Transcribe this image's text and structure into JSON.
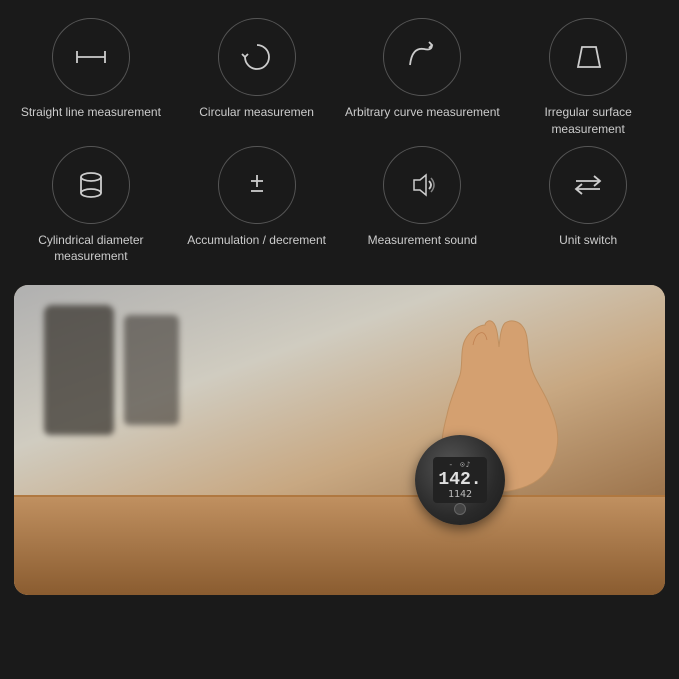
{
  "features": [
    {
      "id": "straight-line",
      "label": "Straight line\nmeasurement",
      "icon": "ruler"
    },
    {
      "id": "circular",
      "label": "Circular\nmeasuremen",
      "icon": "circle-arrow"
    },
    {
      "id": "arbitrary-curve",
      "label": "Arbitrary curve\nmeasurement",
      "icon": "curve"
    },
    {
      "id": "irregular-surface",
      "label": "Irregular surface\nmeasurement",
      "icon": "trapezoid"
    },
    {
      "id": "cylindrical",
      "label": "Cylindrical\ndiameter\nmeasurement",
      "icon": "cylinder"
    },
    {
      "id": "accumulation",
      "label": "Accumulation /\ndecrement",
      "icon": "plusminus"
    },
    {
      "id": "sound",
      "label": "Measurement\nsound",
      "icon": "speaker"
    },
    {
      "id": "unit-switch",
      "label": "Unit switch",
      "icon": "switch"
    }
  ],
  "device": {
    "reading_main": "142.",
    "reading_sub": "1142",
    "icons_top": "- ⊙♪"
  }
}
